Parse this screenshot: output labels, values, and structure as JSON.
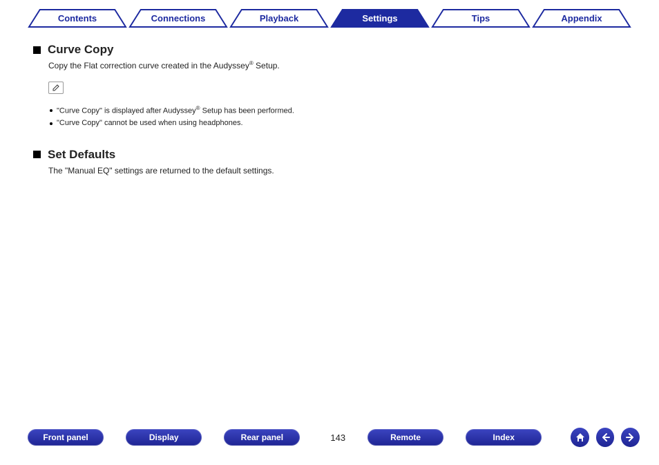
{
  "tabs": [
    {
      "label": "Contents",
      "active": false
    },
    {
      "label": "Connections",
      "active": false
    },
    {
      "label": "Playback",
      "active": false
    },
    {
      "label": "Settings",
      "active": true
    },
    {
      "label": "Tips",
      "active": false
    },
    {
      "label": "Appendix",
      "active": false
    }
  ],
  "sections": {
    "curve_copy": {
      "title": "Curve Copy",
      "desc_pre": "Copy the Flat correction curve created in the Audyssey",
      "desc_post": " Setup.",
      "notes": [
        {
          "pre": "\"Curve Copy\" is displayed after Audyssey",
          "post": " Setup has been performed."
        },
        {
          "pre": "\"Curve Copy\" cannot be used when using headphones.",
          "post": ""
        }
      ]
    },
    "set_defaults": {
      "title": "Set Defaults",
      "desc": "The \"Manual EQ\" settings are returned to the default settings."
    }
  },
  "bottom": {
    "buttons": [
      "Front panel",
      "Display",
      "Rear panel"
    ],
    "page": "143",
    "buttons2": [
      "Remote",
      "Index"
    ]
  }
}
